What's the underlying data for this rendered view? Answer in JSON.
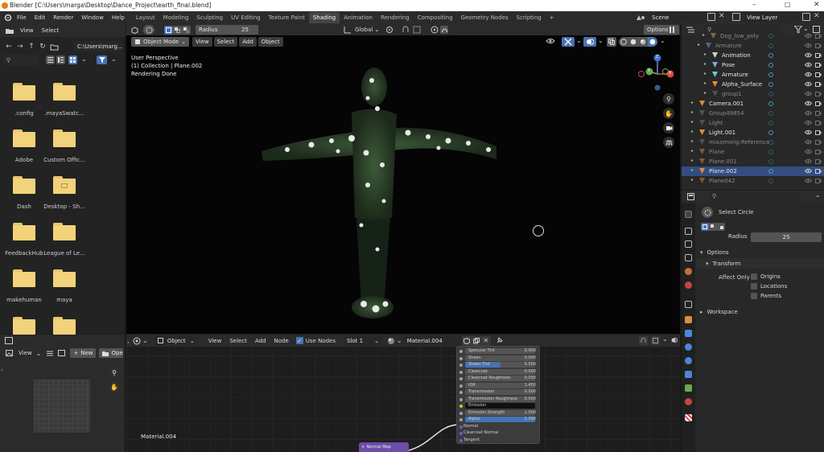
{
  "window": {
    "title": "Blender [C:\\Users\\marga\\Desktop\\Dance_Project\\earth_final.blend]"
  },
  "topbar": {
    "menus": [
      "File",
      "Edit",
      "Render",
      "Window",
      "Help"
    ],
    "workspaces": [
      "Layout",
      "Modeling",
      "Sculpting",
      "UV Editing",
      "Texture Paint",
      "Shading",
      "Animation",
      "Rendering",
      "Compositing",
      "Geometry Nodes",
      "Scripting"
    ],
    "active_workspace": "Shading",
    "add_tab": "+",
    "scene": "Scene",
    "view_layer": "View Layer"
  },
  "filebrowser": {
    "menus": [
      "View",
      "Select"
    ],
    "path": "C:\\Users\\marg...",
    "folders": [
      {
        "name": ".config"
      },
      {
        "name": ".mayaSwatc..."
      },
      {
        "name": "Adobe"
      },
      {
        "name": "Custom Offic..."
      },
      {
        "name": "Dash"
      },
      {
        "name": "Desktop - Sh..."
      },
      {
        "name": "FeedbackHub"
      },
      {
        "name": "League of Le..."
      },
      {
        "name": "makehuman"
      },
      {
        "name": "maya"
      },
      {
        "name": ""
      },
      {
        "name": ""
      }
    ]
  },
  "viewport": {
    "tool_settings": {
      "radius_label": "Radius",
      "radius_value": "25",
      "orientation": "Global",
      "options": "Options"
    },
    "header": {
      "mode": "Object Mode",
      "menus": [
        "View",
        "Select",
        "Add",
        "Object"
      ]
    },
    "overlay_text": {
      "line1": "User Perspective",
      "line2": "(1) Collection | Plane.002",
      "line3": "Rendering Done"
    },
    "gizmo": {
      "x": "X",
      "y": "Y",
      "z": "Z"
    }
  },
  "outliner": {
    "rows": [
      {
        "label": "Dog_low_poly",
        "dim": true
      },
      {
        "label": "Armature",
        "dim": true
      },
      {
        "label": "Animation",
        "dim": false
      },
      {
        "label": "Pose",
        "dim": false
      },
      {
        "label": "Armature",
        "dim": false
      },
      {
        "label": "Alpha_Surface",
        "dim": false
      },
      {
        "label": "group1",
        "dim": true
      },
      {
        "label": "Camera.001",
        "dim": false
      },
      {
        "label": "Group49854",
        "dim": true
      },
      {
        "label": "Light",
        "dim": true
      },
      {
        "label": "Light.001",
        "dim": false
      },
      {
        "label": "mixamorig:Reference",
        "dim": true
      },
      {
        "label": "Plane",
        "dim": true
      },
      {
        "label": "Plane.001",
        "dim": true
      },
      {
        "label": "Plane.002",
        "dim": false,
        "selected": true
      },
      {
        "label": "Plane042",
        "dim": true
      }
    ]
  },
  "properties": {
    "tool_name": "Select Circle",
    "radius_label": "Radius",
    "radius_value": "25",
    "options_header": "Options",
    "transform_header": "Transform",
    "affect_only": "Affect Only",
    "checkboxes": [
      "Origins",
      "Locations",
      "Parents"
    ],
    "workspace_header": "Workspace"
  },
  "imgeditor": {
    "view": "View",
    "new": "New",
    "open": "Open"
  },
  "nodeeditor": {
    "object": "Object",
    "menus": [
      "View",
      "Select",
      "Add",
      "Node"
    ],
    "use_nodes": "Use Nodes",
    "slot": "Slot 1",
    "material": "Material.004",
    "material_label": "Material.004",
    "normal_map": "Normal Map",
    "bsdf_rows": [
      {
        "name": "Specular Tint",
        "value": "0.000",
        "kind": "field"
      },
      {
        "name": "Sheen",
        "value": "0.000",
        "kind": "field"
      },
      {
        "name": "Sheen Tint",
        "value": "0.500",
        "kind": "bar",
        "fill": 0.5
      },
      {
        "name": "Clearcoat",
        "value": "0.000",
        "kind": "field"
      },
      {
        "name": "Clearcoat Roughness",
        "value": "0.030",
        "kind": "field"
      },
      {
        "name": "IOR",
        "value": "1.450",
        "kind": "field"
      },
      {
        "name": "Transmission",
        "value": "0.000",
        "kind": "field"
      },
      {
        "name": "Transmission Roughness",
        "value": "0.000",
        "kind": "field"
      },
      {
        "name": "Emission",
        "value": "",
        "kind": "color"
      },
      {
        "name": "Emission Strength",
        "value": "1.000",
        "kind": "field"
      },
      {
        "name": "Alpha",
        "value": "1.000",
        "kind": "bar",
        "fill": 1.0
      },
      {
        "name": "Normal",
        "value": "",
        "kind": "socket"
      },
      {
        "name": "Clearcoat Normal",
        "value": "",
        "kind": "socket"
      },
      {
        "name": "Tangent",
        "value": "",
        "kind": "socket"
      }
    ]
  },
  "colors": {
    "accent": "#4772b3",
    "selected_row": "#334d80",
    "folder": "#f2d27a"
  }
}
